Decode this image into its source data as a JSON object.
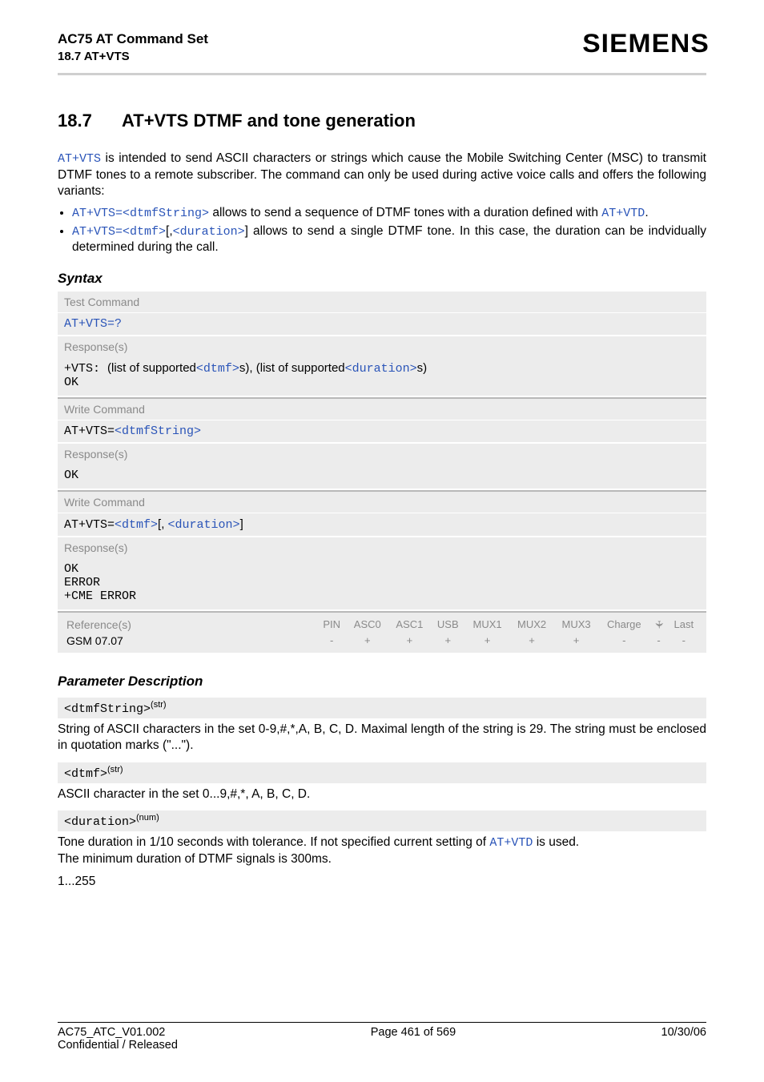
{
  "header": {
    "title_line1": "AC75 AT Command Set",
    "title_line2": "18.7 AT+VTS",
    "brand": "SIEMENS"
  },
  "section": {
    "number": "18.7",
    "title": "AT+VTS   DTMF and tone generation"
  },
  "intro": {
    "cmd": "AT+VTS",
    "rest": " is intended to send ASCII characters or strings which cause the Mobile Switching Center (MSC) to transmit DTMF tones to a remote subscriber. The command can only be used during active voice calls and offers the following variants:"
  },
  "bullets": [
    {
      "code_pre": "AT+VTS=",
      "code_arg": "<dtmfString>",
      "text": " allows to send a sequence of DTMF tones with a duration defined with ",
      "code_post": "AT+VTD",
      "tail": "."
    },
    {
      "code_pre": "AT+VTS=",
      "code_arg": "<dtmf>",
      "mid": "[,",
      "code_arg2": "<duration>",
      "after_arg2": "]",
      "text": " allows to send a single DTMF tone. In this case, the duration can be indvidually determined during the call."
    }
  ],
  "syntax_label": "Syntax",
  "syntax": {
    "labels": {
      "test": "Test Command",
      "write": "Write Command",
      "resp": "Response(s)"
    },
    "test_cmd": "AT+VTS=?",
    "test_resp_pre": "+VTS: ",
    "test_resp_mid1": "(list of supported",
    "test_resp_dtmf": "<dtmf>",
    "test_resp_mid2": "s), (list of supported",
    "test_resp_dur": "<duration>",
    "test_resp_tail": "s)",
    "ok": "OK",
    "write1_pre": "AT+VTS=",
    "write1_arg": "<dtmfString>",
    "write2_pre": "AT+VTS=",
    "write2_a": "<dtmf>",
    "write2_mid": "[, ",
    "write2_b": "<duration>",
    "write2_tail": "]",
    "write2_r1": "OK",
    "write2_r2": "ERROR",
    "write2_r3": "+CME ERROR"
  },
  "ref": {
    "label": "Reference(s)",
    "cols": [
      "PIN",
      "ASC0",
      "ASC1",
      "USB",
      "MUX1",
      "MUX2",
      "MUX3",
      "Charge",
      "✈",
      "Last"
    ],
    "row_label": "GSM 07.07",
    "vals": [
      "-",
      "+",
      "+",
      "+",
      "+",
      "+",
      "+",
      "-",
      "-",
      "-"
    ]
  },
  "param_label": "Parameter Description",
  "params": {
    "p1": {
      "name": "<dtmfString>",
      "type": "(str)",
      "desc": "String of ASCII characters in the set 0-9,#,*,A, B, C, D. Maximal length of the string is 29. The string must be enclosed in quotation marks (\"...\")."
    },
    "p2": {
      "name": "<dtmf>",
      "type": "(str)",
      "desc": "ASCII character in the set 0...9,#,*, A, B, C, D."
    },
    "p3": {
      "name": "<duration>",
      "type": "(num)",
      "desc_a": "Tone duration in 1/10 seconds with tolerance. If not specified current setting of ",
      "desc_cmd": "AT+VTD",
      "desc_b": " is used.",
      "desc_line2": "The minimum duration of DTMF signals is 300ms.",
      "range": "1...255"
    }
  },
  "footer": {
    "left1": "AC75_ATC_V01.002",
    "center": "Page 461 of 569",
    "right": "10/30/06",
    "left2": "Confidential / Released"
  }
}
